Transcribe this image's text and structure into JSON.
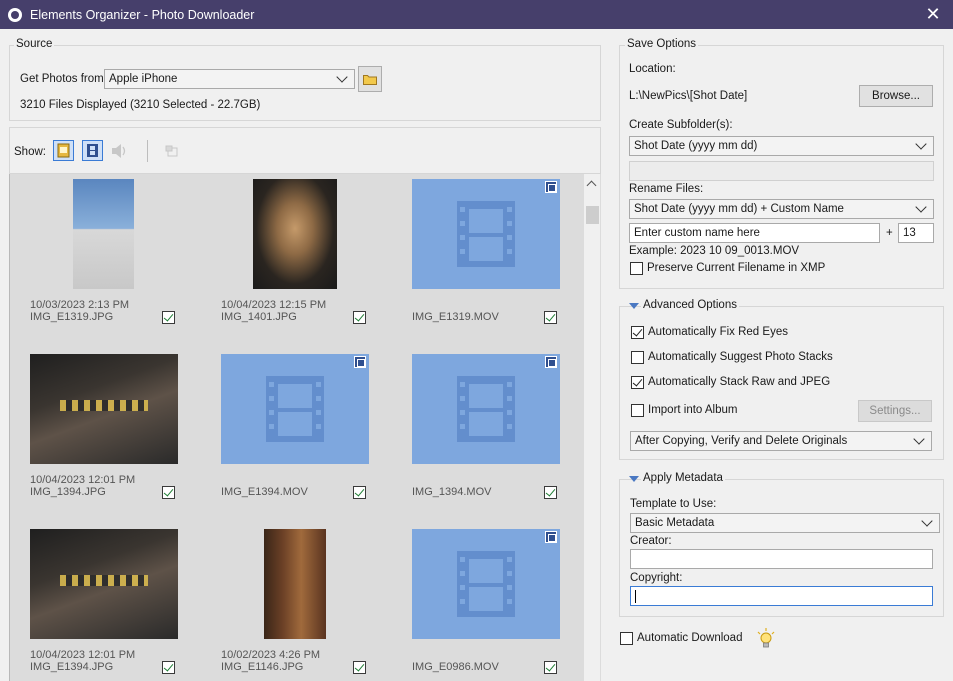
{
  "window": {
    "title": "Elements Organizer - Photo Downloader",
    "close_glyph": "✕"
  },
  "source": {
    "label": "Source",
    "get_photos_label": "Get Photos from:",
    "device": "Apple iPhone",
    "files_status": "3210 Files Displayed (3210 Selected - 22.7GB)"
  },
  "toolbar": {
    "show_label": "Show:"
  },
  "thumbnails": [
    {
      "date": "10/03/2023 2:13 PM",
      "name": "IMG_E1319.JPG",
      "checked": true
    },
    {
      "date": "10/04/2023 12:15 PM",
      "name": "IMG_1401.JPG",
      "checked": true
    },
    {
      "date": "",
      "name": "IMG_E1319.MOV",
      "checked": true
    },
    {
      "date": "10/04/2023 12:01 PM",
      "name": "IMG_1394.JPG",
      "checked": true
    },
    {
      "date": "",
      "name": "IMG_E1394.MOV",
      "checked": true
    },
    {
      "date": "",
      "name": "IMG_1394.MOV",
      "checked": true
    },
    {
      "date": "10/04/2023 12:01 PM",
      "name": "IMG_E1394.JPG",
      "checked": true
    },
    {
      "date": "10/02/2023 4:26 PM",
      "name": "IMG_E1146.JPG",
      "checked": true
    },
    {
      "date": "",
      "name": "IMG_E0986.MOV",
      "checked": true
    }
  ],
  "save_options": {
    "label": "Save Options",
    "location_label": "Location:",
    "location_path": "L:\\NewPics\\[Shot Date]",
    "browse_label": "Browse...",
    "subfolder_label": "Create Subfolder(s):",
    "subfolder_value": "Shot Date (yyyy mm dd)",
    "rename_label": "Rename Files:",
    "rename_value": "Shot Date (yyyy mm dd) + Custom Name",
    "custom_name": "Enter custom name here",
    "plus": "+",
    "counter": "13",
    "example": "Example:  2023 10 09_0013.MOV",
    "preserve_label": "Preserve Current Filename in XMP"
  },
  "advanced": {
    "label": "Advanced Options",
    "red_eye": "Automatically Fix Red Eyes",
    "suggest_stacks": "Automatically Suggest Photo Stacks",
    "stack_raw": "Automatically Stack Raw and JPEG",
    "import_album": "Import into Album",
    "settings_label": "Settings...",
    "after_copy": "After Copying, Verify and Delete Originals"
  },
  "metadata": {
    "label": "Apply Metadata",
    "template_label": "Template to Use:",
    "template_value": "Basic Metadata",
    "creator_label": "Creator:",
    "creator_value": "",
    "copyright_label": "Copyright:",
    "copyright_value": ""
  },
  "auto_download_label": "Automatic Download",
  "colors": {
    "titlebar": "#463f6b",
    "video_tile": "#7ea7de",
    "focus_border": "#3a7bd5"
  }
}
